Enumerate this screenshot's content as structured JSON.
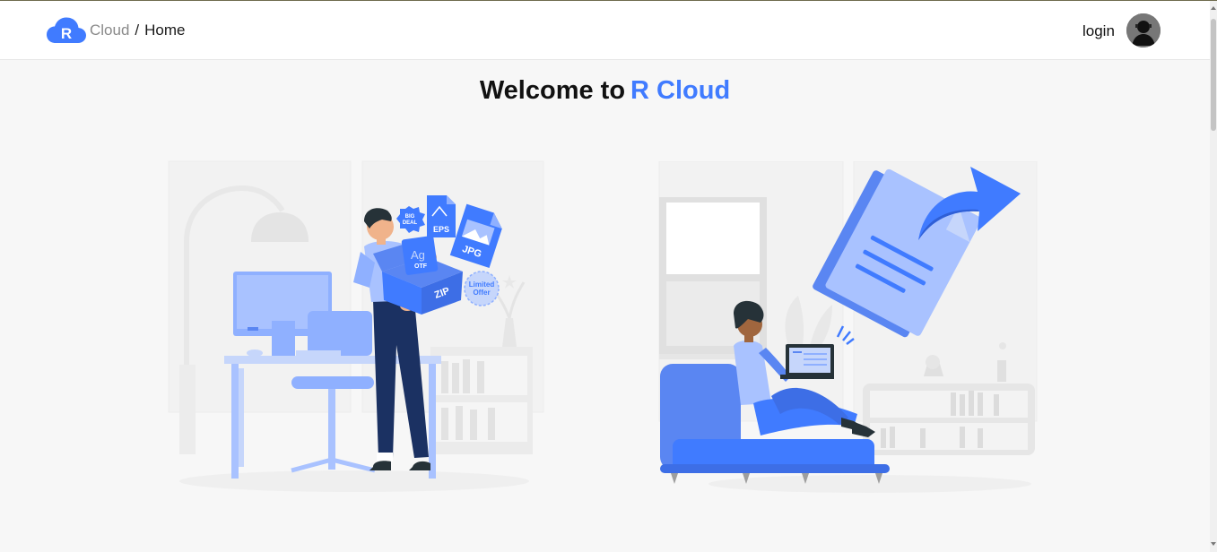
{
  "header": {
    "logo_letter": "R",
    "breadcrumb": {
      "parent": "Cloud",
      "separator": "/",
      "current": "Home"
    },
    "login_label": "login"
  },
  "hero": {
    "title_prefix": "Welcome to",
    "title_brand": "R Cloud"
  },
  "illustration_left": {
    "tags": {
      "big_deal_line1": "BIG",
      "big_deal_line2": "DEAL",
      "eps": "EPS",
      "jpg": "JPG",
      "font_sample": "Ag",
      "font_ext": "OTF",
      "zip": "ZIP",
      "offer_line1": "Limited",
      "offer_line2": "Offer"
    }
  },
  "colors": {
    "accent": "#407bff",
    "accent_light": "#8fb0ff",
    "accent_pale": "#c6d6fb",
    "navy": "#1b3162",
    "background": "#f7f7f7"
  },
  "icons": [
    "cloud-logo-icon",
    "avatar-icon"
  ]
}
